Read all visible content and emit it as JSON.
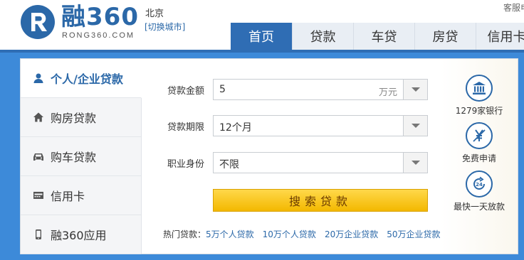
{
  "header": {
    "logo_cn": "融360",
    "logo_en": "RONG360.COM",
    "city": "北京",
    "switch_city": "[切换城市]",
    "service": "客服电话"
  },
  "nav": {
    "items": [
      {
        "label": "首页",
        "active": true
      },
      {
        "label": "贷款"
      },
      {
        "label": "车贷"
      },
      {
        "label": "房贷"
      },
      {
        "label": "信用卡"
      }
    ]
  },
  "sidebar": {
    "items": [
      {
        "label": "个人/企业贷款",
        "icon": "person-icon",
        "active": true
      },
      {
        "label": "购房贷款",
        "icon": "house-icon"
      },
      {
        "label": "购车贷款",
        "icon": "car-icon"
      },
      {
        "label": "信用卡",
        "icon": "credit-card-icon"
      },
      {
        "label": "融360应用",
        "icon": "mobile-phone-icon"
      }
    ]
  },
  "form": {
    "amount": {
      "label": "贷款金额",
      "value": "5",
      "unit": "万元"
    },
    "term": {
      "label": "贷款期限",
      "value": "12个月"
    },
    "occupation": {
      "label": "职业身份",
      "value": "不限"
    },
    "search_button": "搜索贷款",
    "hot": {
      "label": "热门贷款：",
      "links": [
        "5万个人贷款",
        "10万个人贷款",
        "20万企业贷款",
        "50万企业贷款"
      ]
    }
  },
  "features": {
    "banks": {
      "label": "1279家银行",
      "icon": "bank-icon"
    },
    "free": {
      "label": "免费申请",
      "icon": "yen-free-icon"
    },
    "fast": {
      "label": "最快一天放款",
      "icon": "clock-24-icon"
    }
  },
  "colors": {
    "brand_blue": "#2f6db4",
    "stage_blue": "#3d8ad9",
    "button_yellow": "#f3b800"
  }
}
